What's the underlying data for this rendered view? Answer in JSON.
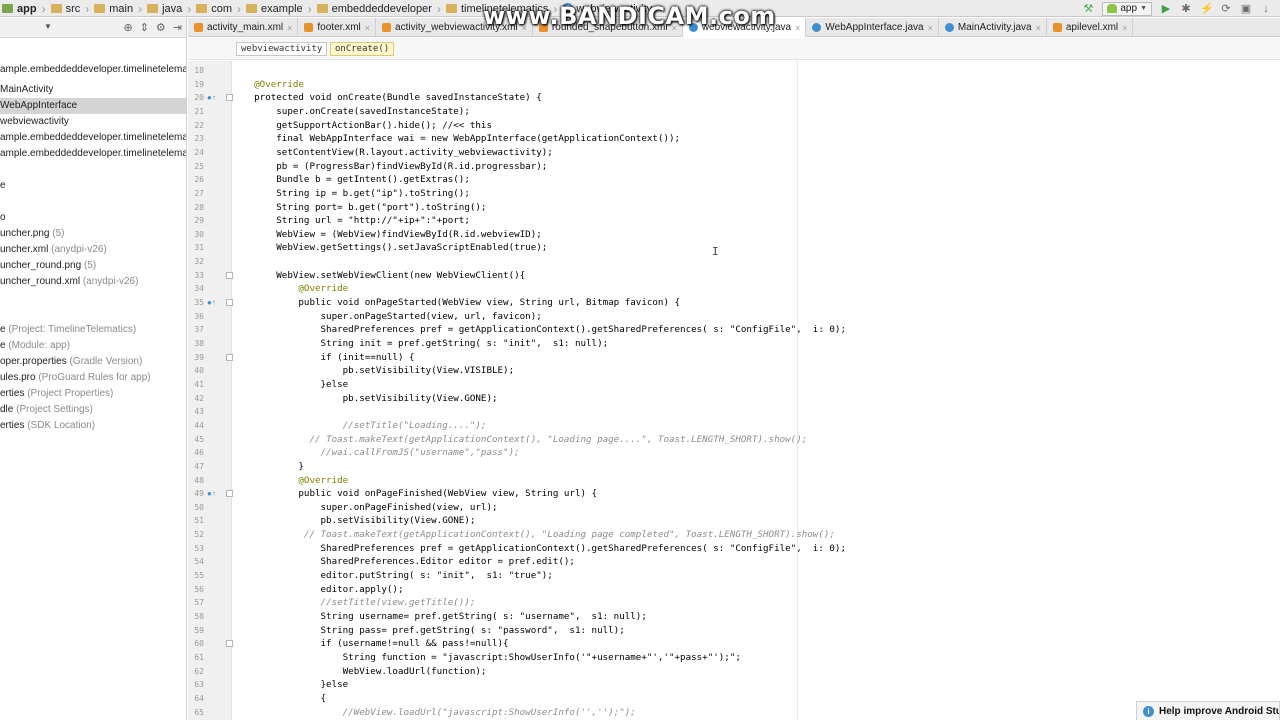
{
  "navbar": {
    "breadcrumb": [
      "app",
      "src",
      "main",
      "java",
      "com",
      "example",
      "embeddeddeveloper",
      "timelinetelematics",
      "webviewactivity"
    ],
    "run_config": "app"
  },
  "watermark": "www.BANDICAM.com",
  "tabs": [
    {
      "label": "activity_main.xml",
      "type": "xml",
      "active": false
    },
    {
      "label": "footer.xml",
      "type": "xml",
      "active": false
    },
    {
      "label": "activity_webviewactivity.xml",
      "type": "xml",
      "active": false
    },
    {
      "label": "rounded_shapebutton.xml",
      "type": "xml",
      "active": false
    },
    {
      "label": "webviewactivity.java",
      "type": "java",
      "active": true
    },
    {
      "label": "WebAppInterface.java",
      "type": "java",
      "active": false
    },
    {
      "label": "MainActivity.java",
      "type": "java",
      "active": false
    },
    {
      "label": "apilevel.xml",
      "type": "xml",
      "active": false
    }
  ],
  "editor_breadcrumb": {
    "class_name": "webviewactivity",
    "method_name": "onCreate()"
  },
  "project_tree": [
    {
      "text": "ample.embeddeddeveloper.timelinetelemati",
      "hint": ""
    },
    {
      "text": "MainActivity",
      "hint": ""
    },
    {
      "text": "WebAppInterface",
      "hint": "",
      "selected": true
    },
    {
      "text": "webviewactivity",
      "hint": ""
    },
    {
      "text": "ample.embeddeddeveloper.timelinetelemati",
      "hint": ""
    },
    {
      "text": "ample.embeddeddeveloper.timelinetelemati",
      "hint": ""
    },
    {
      "text": "e",
      "hint": ""
    },
    {
      "text": "o",
      "hint": ""
    },
    {
      "text": "uncher.png",
      "hint": " (5)"
    },
    {
      "text": "uncher.xml",
      "hint": " (anydpi-v26)"
    },
    {
      "text": "uncher_round.png",
      "hint": " (5)"
    },
    {
      "text": "uncher_round.xml",
      "hint": " (anydpi-v26)"
    },
    {
      "text": "e",
      "hint": " (Project: TimelineTelematics)"
    },
    {
      "text": "e",
      "hint": " (Module: app)"
    },
    {
      "text": "oper.properties",
      "hint": " (Gradle Version)"
    },
    {
      "text": "ules.pro",
      "hint": " (ProGuard Rules for app)"
    },
    {
      "text": "erties",
      "hint": " (Project Properties)"
    },
    {
      "text": "dle",
      "hint": " (Project Settings)"
    },
    {
      "text": "erties",
      "hint": " (SDK Location)"
    }
  ],
  "code": [
    {
      "n": 18,
      "t": "",
      "s": ""
    },
    {
      "n": 19,
      "t": "    @Override",
      "s": "ann"
    },
    {
      "n": 20,
      "t": "    protected void onCreate(Bundle savedInstanceState) {",
      "s": "kw",
      "m": "o↑"
    },
    {
      "n": 21,
      "t": "        super.onCreate(savedInstanceState);",
      "s": ""
    },
    {
      "n": 22,
      "t": "        getSupportActionBar().hide(); //<< this",
      "s": ""
    },
    {
      "n": 23,
      "t": "        final WebAppInterface wai = new WebAppInterface(getApplicationContext());",
      "s": ""
    },
    {
      "n": 24,
      "t": "        setContentView(R.layout.activity_webviewactivity);",
      "s": ""
    },
    {
      "n": 25,
      "t": "        pb = (ProgressBar)findViewById(R.id.progressbar);",
      "s": ""
    },
    {
      "n": 26,
      "t": "        Bundle b = getIntent().getExtras();",
      "s": ""
    },
    {
      "n": 27,
      "t": "        String ip = b.get(\"ip\").toString();",
      "s": ""
    },
    {
      "n": 28,
      "t": "        String port= b.get(\"port\").toString();",
      "s": ""
    },
    {
      "n": 29,
      "t": "        String url = \"http://\"+ip+\":\"+port;",
      "s": ""
    },
    {
      "n": 30,
      "t": "        WebView = (WebView)findViewById(R.id.webviewID);",
      "s": ""
    },
    {
      "n": 31,
      "t": "        WebView.getSettings().setJavaScriptEnabled(true);",
      "s": ""
    },
    {
      "n": 32,
      "t": "",
      "s": ""
    },
    {
      "n": 33,
      "t": "        WebView.setWebViewClient(new WebViewClient(){",
      "s": ""
    },
    {
      "n": 34,
      "t": "            @Override",
      "s": "ann"
    },
    {
      "n": 35,
      "t": "            public void onPageStarted(WebView view, String url, Bitmap favicon) {",
      "s": "kw",
      "m": "o↑"
    },
    {
      "n": 36,
      "t": "                super.onPageStarted(view, url, favicon);",
      "s": ""
    },
    {
      "n": 37,
      "t": "                SharedPreferences pref = getApplicationContext().getSharedPreferences( s: \"ConfigFile\",  i: 0);",
      "s": ""
    },
    {
      "n": 38,
      "t": "                String init = pref.getString( s: \"init\",  s1: null);",
      "s": ""
    },
    {
      "n": 39,
      "t": "                if (init==null) {",
      "s": ""
    },
    {
      "n": 40,
      "t": "                    pb.setVisibility(View.VISIBLE);",
      "s": ""
    },
    {
      "n": 41,
      "t": "                }else",
      "s": ""
    },
    {
      "n": 42,
      "t": "                    pb.setVisibility(View.GONE);",
      "s": ""
    },
    {
      "n": 43,
      "t": "",
      "s": ""
    },
    {
      "n": 44,
      "t": "                    //setTitle(\"Loading....\");",
      "s": "cm"
    },
    {
      "n": 45,
      "t": "              // Toast.makeText(getApplicationContext(), \"Loading page....\", Toast.LENGTH_SHORT).show();",
      "s": "cm"
    },
    {
      "n": 46,
      "t": "                //wai.callFromJS(\"username\",\"pass\");",
      "s": "cm"
    },
    {
      "n": 47,
      "t": "            }",
      "s": ""
    },
    {
      "n": 48,
      "t": "            @Override",
      "s": "ann"
    },
    {
      "n": 49,
      "t": "            public void onPageFinished(WebView view, String url) {",
      "s": "kw",
      "m": "o↑"
    },
    {
      "n": 50,
      "t": "                super.onPageFinished(view, url);",
      "s": ""
    },
    {
      "n": 51,
      "t": "                pb.setVisibility(View.GONE);",
      "s": ""
    },
    {
      "n": 52,
      "t": "             // Toast.makeText(getApplicationContext(), \"Loading page completed\", Toast.LENGTH_SHORT).show();",
      "s": "cm"
    },
    {
      "n": 53,
      "t": "                SharedPreferences pref = getApplicationContext().getSharedPreferences( s: \"ConfigFile\",  i: 0);",
      "s": ""
    },
    {
      "n": 54,
      "t": "                SharedPreferences.Editor editor = pref.edit();",
      "s": ""
    },
    {
      "n": 55,
      "t": "                editor.putString( s: \"init\",  s1: \"true\");",
      "s": ""
    },
    {
      "n": 56,
      "t": "                editor.apply();",
      "s": ""
    },
    {
      "n": 57,
      "t": "                //setTitle(view.getTitle());",
      "s": "cm"
    },
    {
      "n": 58,
      "t": "                String username= pref.getString( s: \"username\",  s1: null);",
      "s": ""
    },
    {
      "n": 59,
      "t": "                String pass= pref.getString( s: \"password\",  s1: null);",
      "s": ""
    },
    {
      "n": 60,
      "t": "                if (username!=null && pass!=null){",
      "s": ""
    },
    {
      "n": 61,
      "t": "                    String function = \"javascript:ShowUserInfo('\"+username+\"','\"+pass+\"');\";",
      "s": ""
    },
    {
      "n": 62,
      "t": "                    WebView.loadUrl(function);",
      "s": ""
    },
    {
      "n": 63,
      "t": "                }else",
      "s": ""
    },
    {
      "n": 64,
      "t": "                {",
      "s": ""
    },
    {
      "n": 65,
      "t": "                    //WebView.loadUrl(\"javascript:ShowUserInfo('','');\");",
      "s": "cm"
    }
  ],
  "notification": {
    "text": "Help improve Android Stud"
  },
  "icons": {
    "tab_close": "close-icon",
    "notify": "info-icon"
  },
  "colors": {
    "annotation": "#808000",
    "comment": "#8c8c8c",
    "java_icon": "#3d8fd0",
    "xml_icon": "#e8912d"
  }
}
